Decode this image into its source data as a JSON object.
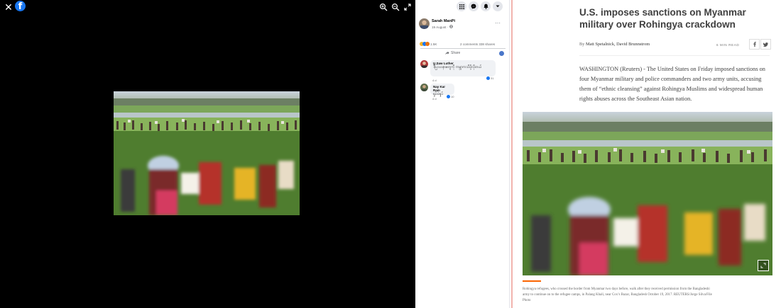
{
  "viewer": {
    "close_icon": "close-icon",
    "logo_letter": "f",
    "tools": [
      "zoom-in-icon",
      "zoom-out-icon",
      "fullscreen-icon"
    ]
  },
  "post": {
    "author": "Sarah ManPi",
    "date": "19 August",
    "privacy_icon": "globe-icon",
    "reaction_count": "1.5K",
    "comments": "2 comments",
    "shares": "338 shares",
    "share_label": "Share",
    "topbar_icons": [
      "apps-grid-icon",
      "messenger-icon",
      "notifications-icon",
      "account-menu-icon"
    ]
  },
  "comments": [
    {
      "name": "U Saw Luther",
      "text": "ဒီပြဿနာတွေကို ကမ္ဘာကသိဖို့လိုတယ်",
      "actions": "4 d",
      "reactions": "31"
    },
    {
      "name": "Nay Kar Ram",
      "text": "ရှုပ်ပဲရှုပ်",
      "actions": "4 d",
      "reactions": "10"
    }
  ],
  "article": {
    "headline": "U.S. imposes sanctions on Myanmar military over Rohingya crackdown",
    "by_prefix": "By",
    "authors": "Matt Spetalnick, David Brunnstrom",
    "read_time": "6 MIN READ",
    "lead": "WASHINGTON (Reuters) - The United States on Friday imposed sanctions on four Myanmar military and police commanders and two army units, accusing them of “ethnic cleansing” against Rohingya Muslims and widespread human rights abuses across the Southeast Asian nation.",
    "caption": "Rohingya refugees, who crossed the border from Myanmar two days before, walk after they received permission from the Bangladeshi army to continue on to the refugee camps, in Palang Khali, near Cox’s Bazar, Bangladesh October 19, 2017. REUTERS/Jorge Silva/File Photo"
  },
  "colors": {
    "facebook_blue": "#1877f2",
    "reuters_orange": "#fa6400",
    "viewer_background": "#000000"
  }
}
